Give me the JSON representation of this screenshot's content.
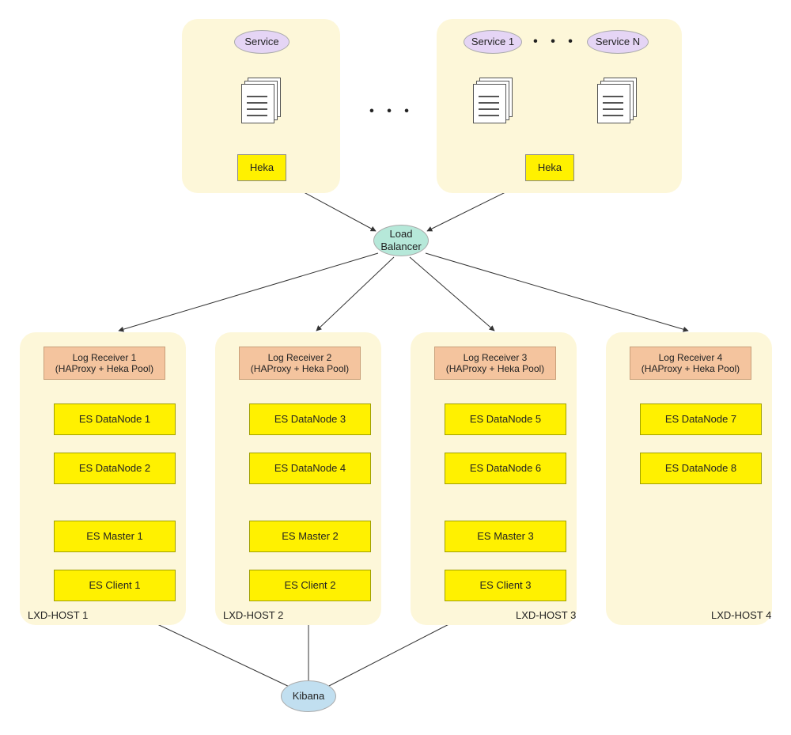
{
  "top": {
    "service_single": "Service",
    "service_1": "Service 1",
    "service_n": "Service N",
    "heka": "Heka",
    "dots": "• • •",
    "top_dots": "• • •"
  },
  "lb": {
    "line1": "Load",
    "line2": "Balancer"
  },
  "kibana": {
    "label": "Kibana"
  },
  "hosts": [
    {
      "label": "LXD-HOST 1",
      "receiver_l1": "Log Receiver 1",
      "receiver_l2": "(HAProxy + Heka Pool)",
      "dn_a": "ES DataNode 1",
      "dn_b": "ES DataNode 2",
      "master": "ES Master 1",
      "client": "ES Client 1"
    },
    {
      "label": "LXD-HOST 2",
      "receiver_l1": "Log Receiver 2",
      "receiver_l2": "(HAProxy + Heka Pool)",
      "dn_a": "ES DataNode 3",
      "dn_b": "ES DataNode 4",
      "master": "ES Master 2",
      "client": "ES Client 2"
    },
    {
      "label": "LXD-HOST 3",
      "receiver_l1": "Log Receiver 3",
      "receiver_l2": "(HAProxy + Heka Pool)",
      "dn_a": "ES DataNode 5",
      "dn_b": "ES DataNode 6",
      "master": "ES Master 3",
      "client": "ES Client 3"
    },
    {
      "label": "LXD-HOST 4",
      "receiver_l1": "Log Receiver 4",
      "receiver_l2": "(HAProxy + Heka Pool)",
      "dn_a": "ES DataNode 7",
      "dn_b": "ES DataNode 8",
      "master": "",
      "client": ""
    }
  ]
}
